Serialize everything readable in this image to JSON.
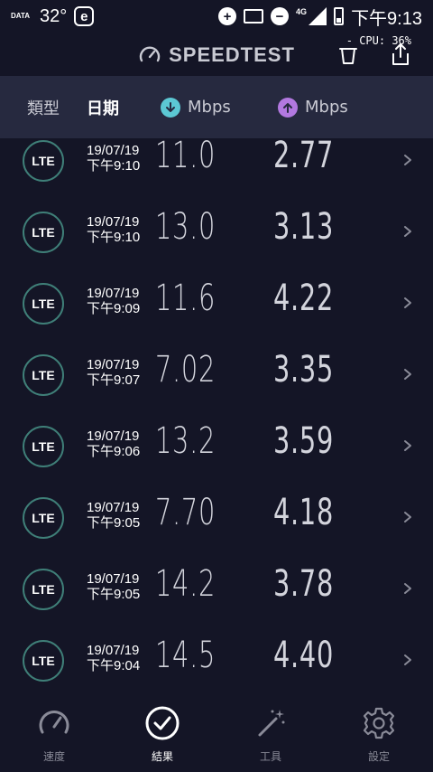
{
  "status_bar": {
    "data_tag": "DATA",
    "temperature": "32°",
    "e_icon_label": "e",
    "network": "4G",
    "time": "下午9:13"
  },
  "header": {
    "title": "SPEEDTEST",
    "cpu": "- CPU: 36%"
  },
  "columns": {
    "type": "類型",
    "date": "日期",
    "download": "Mbps",
    "upload": "Mbps"
  },
  "results": [
    {
      "type": "LTE",
      "date": "19/07/19",
      "time": "下午9:10",
      "download": "11.0",
      "upload": "2.77"
    },
    {
      "type": "LTE",
      "date": "19/07/19",
      "time": "下午9:10",
      "download": "13.0",
      "upload": "3.13"
    },
    {
      "type": "LTE",
      "date": "19/07/19",
      "time": "下午9:09",
      "download": "11.6",
      "upload": "4.22"
    },
    {
      "type": "LTE",
      "date": "19/07/19",
      "time": "下午9:07",
      "download": "7.02",
      "upload": "3.35"
    },
    {
      "type": "LTE",
      "date": "19/07/19",
      "time": "下午9:06",
      "download": "13.2",
      "upload": "3.59"
    },
    {
      "type": "LTE",
      "date": "19/07/19",
      "time": "下午9:05",
      "download": "7.70",
      "upload": "4.18"
    },
    {
      "type": "LTE",
      "date": "19/07/19",
      "time": "下午9:05",
      "download": "14.2",
      "upload": "3.78"
    },
    {
      "type": "LTE",
      "date": "19/07/19",
      "time": "下午9:04",
      "download": "14.5",
      "upload": "4.40"
    }
  ],
  "nav": {
    "speed": "速度",
    "results": "結果",
    "tools": "工具",
    "settings": "設定",
    "active": "results"
  },
  "colors": {
    "background": "#141526",
    "header_bar": "#26293f",
    "download_accent": "#5cc8d4",
    "upload_accent": "#b278e0",
    "lte_ring": "#3f7f78"
  }
}
